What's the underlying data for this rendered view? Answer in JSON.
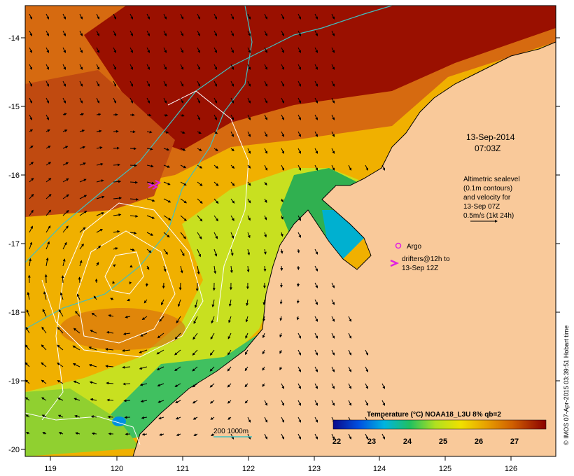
{
  "date_label": "13-Sep-2014",
  "time_label": "07:03Z",
  "altimetry_note": [
    "Altimetric sealevel",
    "(0.1m contours)",
    "and velocity for",
    "13-Sep 07Z",
    "0.5m/s (1kt 24h)"
  ],
  "legend": {
    "argo_label": "Argo",
    "drifter_label_line1": "drifters@12h to",
    "drifter_label_line2": "13-Sep 12Z",
    "argo_color": "#e020e0",
    "drifter_color": "#e020e0"
  },
  "isobath_label": "200  1000m",
  "colorbar": {
    "title": "Temperature (°C) NOAA18_L3U 8% qb=2",
    "ticks": [
      "22",
      "23",
      "24",
      "25",
      "26",
      "27"
    ],
    "colors": [
      "#0a0a8a",
      "#0050e0",
      "#00b4e0",
      "#20c060",
      "#b0e020",
      "#f0e000",
      "#e8a000",
      "#d06000",
      "#a01800",
      "#8a0000"
    ]
  },
  "axes": {
    "x_ticks": [
      "119",
      "120",
      "121",
      "122",
      "123",
      "124",
      "125",
      "126"
    ],
    "y_ticks": [
      "-14",
      "-15",
      "-16",
      "-17",
      "-18",
      "-19",
      "-20"
    ]
  },
  "credit": "© IMOS 07-Apr-2015 03:39:51 Hobart time",
  "colors": {
    "land": "#f9c99a",
    "isobath": "#40c0c0",
    "contour": "#ffffff"
  }
}
